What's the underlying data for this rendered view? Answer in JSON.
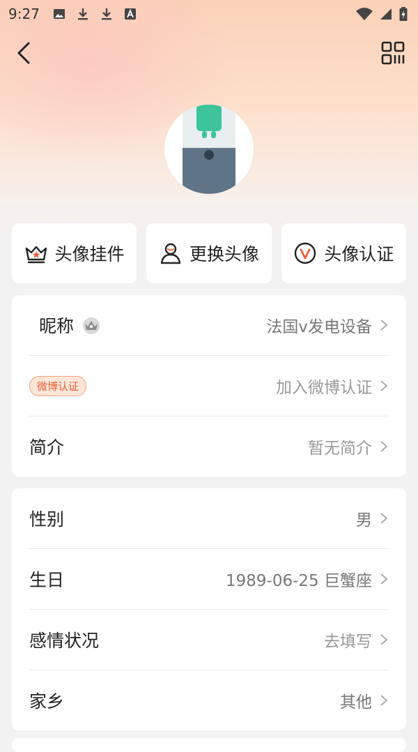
{
  "status_bar": {
    "time": "9:27",
    "left_icons": [
      "image-icon",
      "download-icon",
      "download-icon",
      "font-icon"
    ],
    "right_icons": [
      "wifi-icon",
      "signal-icon",
      "battery-charging-icon"
    ]
  },
  "topbar": {
    "back_icon": "back-arrow-icon",
    "qr_icon": "qr-code-icon"
  },
  "actions": [
    {
      "label": "头像挂件",
      "icon": "crown-icon"
    },
    {
      "label": "更换头像",
      "icon": "user-icon"
    },
    {
      "label": "头像认证",
      "icon": "verified-v-icon"
    }
  ],
  "profile_card": {
    "nickname_label": "昵称",
    "nickname_value": "法国v发电设备",
    "weibo_badge": "微博认证",
    "weibo_value": "加入微博认证",
    "intro_label": "简介",
    "intro_value": "暂无简介"
  },
  "info_card": {
    "gender_label": "性别",
    "gender_value": "男",
    "birthday_label": "生日",
    "birthday_value": "1989-06-25 巨蟹座",
    "relationship_label": "感情状况",
    "relationship_value": "去填写",
    "hometown_label": "家乡",
    "hometown_value": "其他"
  },
  "colors": {
    "accent": "#e8613a",
    "hero_top": "#fbd1b8",
    "background": "#f2f2f2"
  }
}
